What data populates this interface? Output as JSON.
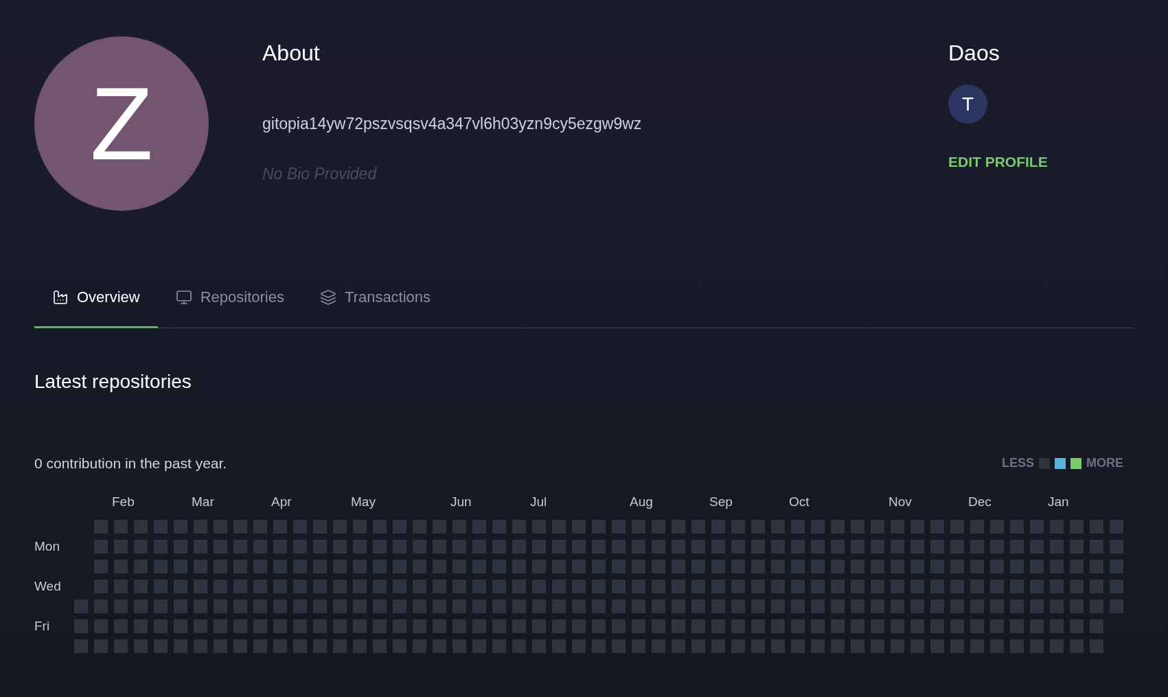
{
  "profile": {
    "avatar": {
      "letter": "Z",
      "color": "#735471"
    },
    "about_title": "About",
    "address": "gitopia14yw72pszvsqsv4a347vl6h03yzn9cy5ezgw9wz",
    "bio": "No Bio Provided"
  },
  "daos": {
    "title": "Daos",
    "items": [
      {
        "letter": "T",
        "color": "#2c3560"
      }
    ],
    "edit_button": "EDIT PROFILE"
  },
  "tabs": [
    {
      "label": "Overview",
      "kind": "overview",
      "selected": true
    },
    {
      "label": "Repositories",
      "kind": "repositories",
      "selected": false
    },
    {
      "label": "Transactions",
      "kind": "transactions",
      "selected": false
    }
  ],
  "latest_repositories": {
    "title": "Latest repositories"
  },
  "contributions": {
    "summary": "0 contribution in the past year.",
    "legend": {
      "less": "LESS",
      "more": "MORE",
      "swatches": [
        {
          "color": "#2d3440"
        },
        {
          "color": "#5ab4e0"
        },
        {
          "color": "#7ccc6e"
        }
      ]
    },
    "months": [
      "Feb",
      "Mar",
      "Apr",
      "May",
      "Jun",
      "Jul",
      "Aug",
      "Sep",
      "Oct",
      "Nov",
      "Dec",
      "Jan"
    ],
    "days": [
      "Mon",
      "Wed",
      "Fri"
    ]
  }
}
